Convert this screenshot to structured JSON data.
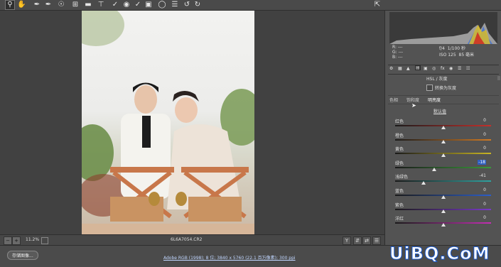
{
  "toolbar": {
    "tools": [
      "zoom-icon",
      "hand-icon",
      "white-balance-icon",
      "color-sampler-icon",
      "target-adjust-icon",
      "crop-icon",
      "straighten-icon",
      "transform-icon",
      "spot-removal-icon",
      "red-eye-icon",
      "adjustment-brush-icon",
      "graduated-filter-icon",
      "radial-filter-icon",
      "preferences-icon",
      "rotate-ccw-icon",
      "rotate-cw-icon"
    ]
  },
  "bottom": {
    "zoom": "11.2%",
    "filename": "6L6A7054.CR2"
  },
  "status": {
    "save_button": "存储图像...",
    "workflow": "Adobe RGB (1998); 8 位; 3840 x 5760 (22.1 百万像素); 300 ppi"
  },
  "info": {
    "r_label": "R:",
    "r_value": "---",
    "g_label": "G:",
    "g_value": "---",
    "b_label": "B:",
    "b_value": "---",
    "aperture": "f/4",
    "shutter": "1/100 秒",
    "iso": "ISO 125",
    "lens": "85 毫米"
  },
  "panel": {
    "title": "HSL / 灰度",
    "convert_label": "转换为灰度",
    "tabs": [
      "色相",
      "饱和度",
      "明亮度"
    ],
    "default_label": "默认值",
    "sliders": [
      {
        "label": "红色",
        "value": "0",
        "level": 0,
        "color": "#c4302b"
      },
      {
        "label": "橙色",
        "value": "0",
        "level": 0,
        "color": "#d07a24"
      },
      {
        "label": "黄色",
        "value": "0",
        "level": 0,
        "color": "#c9b524"
      },
      {
        "label": "绿色",
        "value": "-18",
        "level": -18,
        "color": "#3a9a3a"
      },
      {
        "label": "浅绿色",
        "value": "-41",
        "level": -41,
        "color": "#2fa3a0"
      },
      {
        "label": "蓝色",
        "value": "0",
        "level": 0,
        "color": "#2c5ec8"
      },
      {
        "label": "紫色",
        "value": "0",
        "level": 0,
        "color": "#7a3ac8"
      },
      {
        "label": "洋红",
        "value": "0",
        "level": 0,
        "color": "#c42fb3"
      }
    ]
  },
  "watermark": "UiBQ.CoM"
}
